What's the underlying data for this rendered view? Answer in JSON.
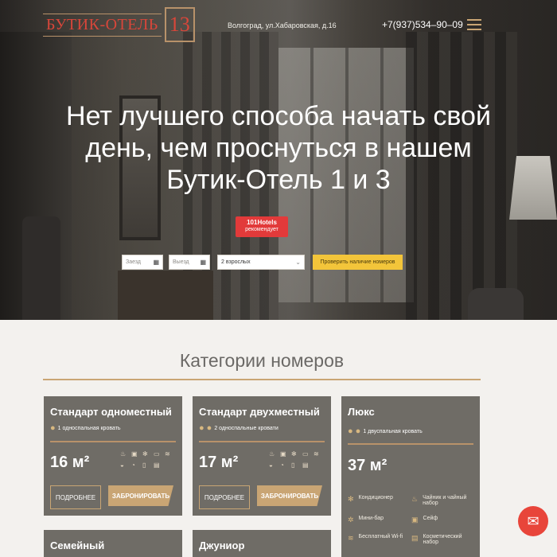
{
  "header": {
    "logo_text": "БУТИК-ОТЕЛЬ",
    "logo_number": "13",
    "address": "Волгоград, ул.Хабаровская, д.16",
    "phone": "+7(937)534–90–09"
  },
  "hero": {
    "headline": "Нет лучшего способа начать свой день, чем проснуться в нашем Бутик-Отель 1 и 3",
    "badge_title": "101Hotels",
    "badge_sub": "рекомендует"
  },
  "booking": {
    "checkin_placeholder": "Заезд",
    "checkout_placeholder": "Выезд",
    "guests_value": "2 взрослых",
    "check_button": "Проверить наличие номеров"
  },
  "categories": {
    "title": "Категории номеров",
    "more_label": "ПОДРОБНЕЕ",
    "book_label": "ЗАБРОНИРОВАТЬ",
    "cards": [
      {
        "title": "Стандарт одноместный",
        "bed": "1 односпальная кровать",
        "size": "16 м²"
      },
      {
        "title": "Стандарт двухместный",
        "bed": "2 односпальные кровати",
        "size": "17 м²"
      },
      {
        "title": "Люкс",
        "bed": "1 двуспальная кровать",
        "size": "37 м²",
        "amenities": [
          "Кондиционер",
          "Чайник и чайный набор",
          "Мини-бар",
          "Сейф",
          "Бесплатный Wi-fi",
          "Косметический набор"
        ]
      },
      {
        "title": "Семейный"
      },
      {
        "title": "Джуниор"
      }
    ]
  },
  "icons": {
    "person": "person-icon",
    "chat": "chat-icon",
    "menu": "burger-icon"
  },
  "colors": {
    "accent_gold": "#c9a574",
    "card_bg": "#6f6c66",
    "check_button": "#f3c53a",
    "badge_red": "#e23a3a",
    "logo_red": "#d8463a"
  }
}
